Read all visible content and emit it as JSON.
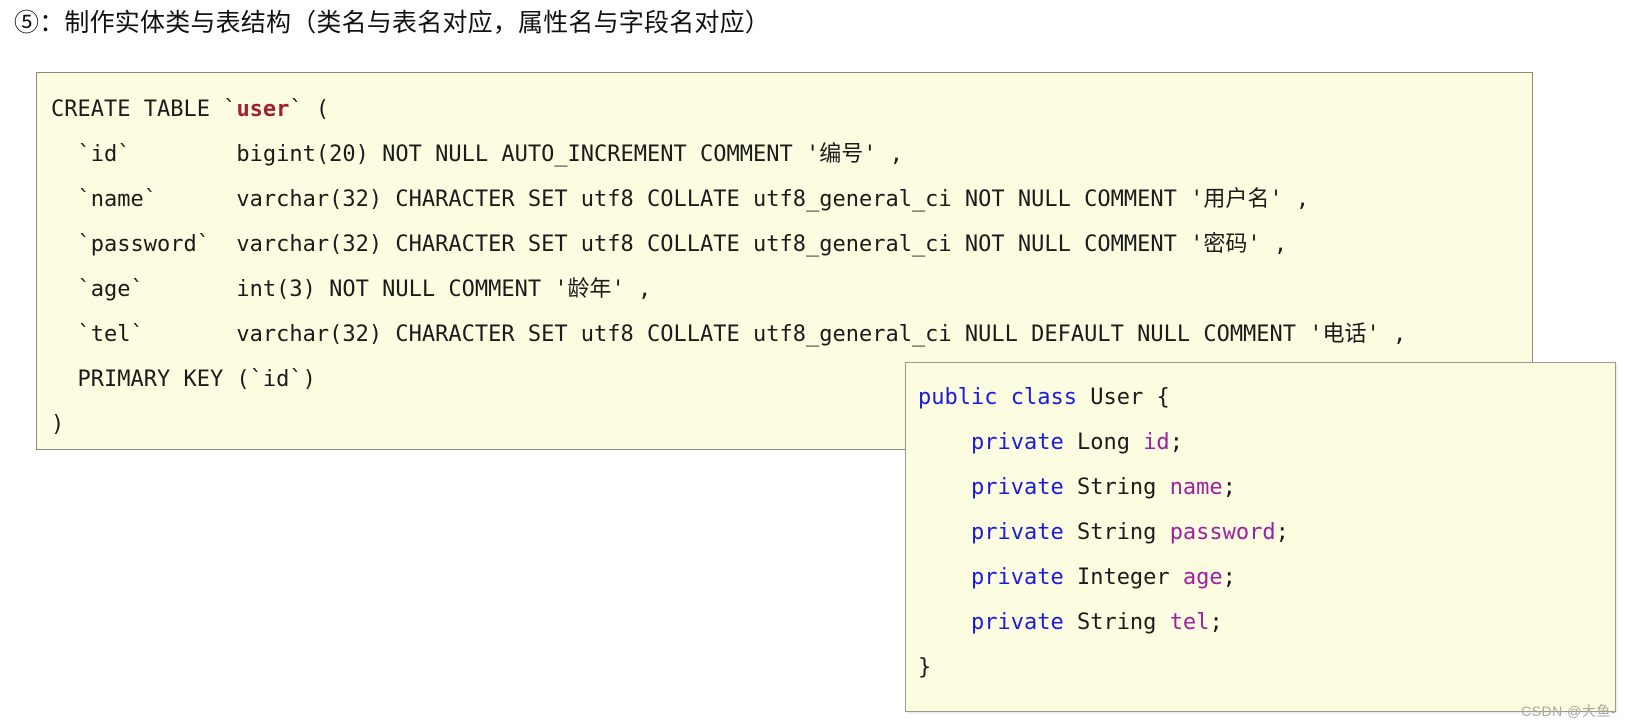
{
  "heading": {
    "text": "⑤：制作实体类与表结构（类名与表名对应，属性名与字段名对应）"
  },
  "sql_block": {
    "table_name": "user",
    "lines": [
      {
        "id": "line-create",
        "prefix": "CREATE TABLE `",
        "table": "user",
        "suffix": "` ("
      },
      {
        "id": "line-id",
        "text": "  `id`        bigint(20) NOT NULL AUTO_INCREMENT COMMENT '编号' ,"
      },
      {
        "id": "line-name",
        "text": "  `name`      varchar(32) CHARACTER SET utf8 COLLATE utf8_general_ci NOT NULL COMMENT '用户名' ,"
      },
      {
        "id": "line-password",
        "text": "  `password`  varchar(32) CHARACTER SET utf8 COLLATE utf8_general_ci NOT NULL COMMENT '密码' ,"
      },
      {
        "id": "line-age",
        "text": "  `age`       int(3) NOT NULL COMMENT '龄年' ,"
      },
      {
        "id": "line-tel",
        "text": "  `tel`       varchar(32) CHARACTER SET utf8 COLLATE utf8_general_ci NULL DEFAULT NULL COMMENT '电话' ,"
      },
      {
        "id": "line-pk",
        "text": "  PRIMARY KEY (`id`)"
      },
      {
        "id": "line-close",
        "text": ")"
      }
    ]
  },
  "java_block": {
    "class_line": {
      "kw_public": "public",
      "kw_class": "class",
      "name": "User",
      "brace": "{"
    },
    "fields": [
      {
        "kw": "private",
        "type": "Long",
        "name": "id",
        "semi": ";"
      },
      {
        "kw": "private",
        "type": "String",
        "name": "name",
        "semi": ";"
      },
      {
        "kw": "private",
        "type": "String",
        "name": "password",
        "semi": ";"
      },
      {
        "kw": "private",
        "type": "Integer",
        "name": "age",
        "semi": ";"
      },
      {
        "kw": "private",
        "type": "String",
        "name": "tel",
        "semi": ";"
      }
    ],
    "close_brace": "}"
  },
  "watermark": {
    "text": "CSDN @大鱼-"
  },
  "colors": {
    "code_background": "#fcfce0",
    "code_border": "#8a8a80",
    "keyword_blue": "#1a1ae0",
    "field_purple": "#a020a0",
    "table_red": "#a02030",
    "text": "#1b1b1b",
    "watermark": "#a8a8a0"
  }
}
